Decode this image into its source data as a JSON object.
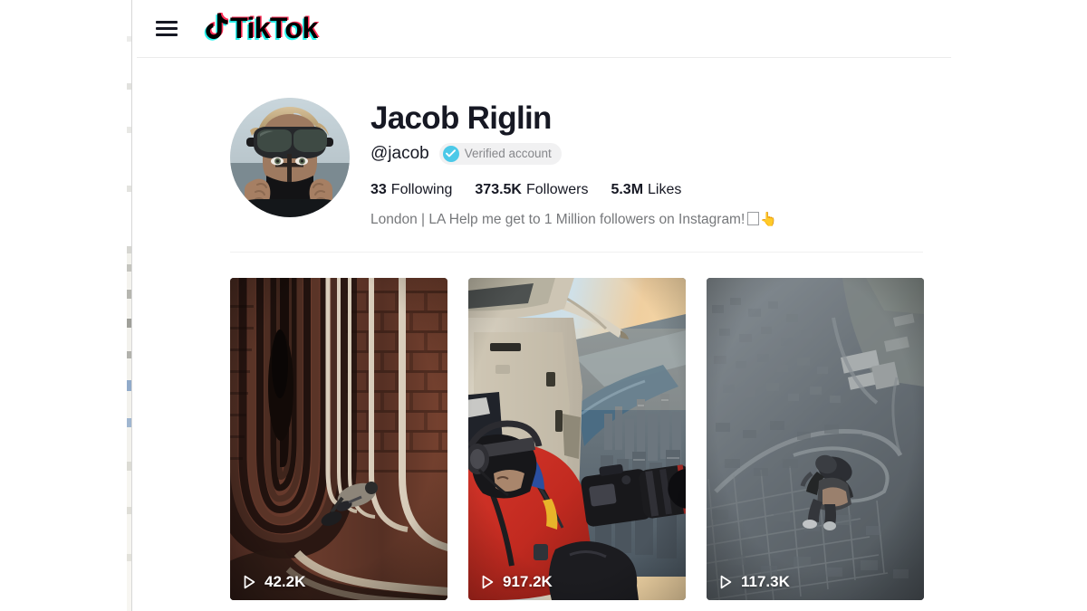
{
  "header": {
    "menu_icon": "hamburger-menu-icon",
    "logo_text": "TikTok",
    "logo_note_icon": "music-note-icon",
    "logo_colors": {
      "cyan": "#25F4EE",
      "pink": "#FE2C55",
      "black": "#010101"
    }
  },
  "profile": {
    "avatar_alt": "Jacob Riglin profile photo",
    "display_name": "Jacob Riglin",
    "handle": "@jacob",
    "verified": {
      "icon": "verified-check-icon",
      "label": "Verified account",
      "badge_color": "#4CC9E8"
    },
    "stats": [
      {
        "value": "33",
        "label": "Following"
      },
      {
        "value": "373.5K",
        "label": "Followers"
      },
      {
        "value": "5.3M",
        "label": "Likes"
      }
    ],
    "bio": "London | LA Help me get to 1 Million followers on Instagram!",
    "bio_emoji": "👆"
  },
  "videos": [
    {
      "id": "video-1",
      "play_icon": "play-triangle-icon",
      "views": "42.2K",
      "thumbnail_alt": "Cyclist riding through brick viaduct arches"
    },
    {
      "id": "video-2",
      "play_icon": "play-triangle-icon",
      "views": "917.2K",
      "thumbnail_alt": "Photographer in red jacket shooting from helicopter over New York City"
    },
    {
      "id": "video-3",
      "play_icon": "play-triangle-icon",
      "views": "117.3K",
      "thumbnail_alt": "Skydiver falling above aerial view of a city"
    }
  ]
}
